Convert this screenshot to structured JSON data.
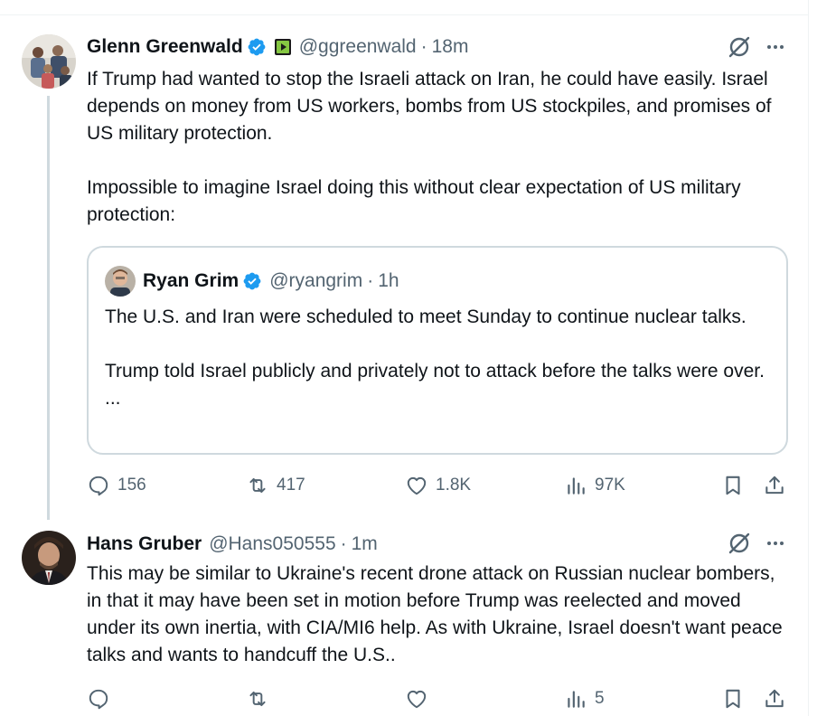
{
  "tweets": [
    {
      "author": "Glenn Greenwald",
      "handle": "@ggreenwald",
      "time": "18m",
      "verified": true,
      "text": "If Trump had wanted to stop the Israeli attack on Iran, he could have easily. Israel depends on money from US workers, bombs from US stockpiles, and promises of US military protection.\n\nImpossible to imagine Israel doing this without clear expectation of US military protection:",
      "quote": {
        "author": "Ryan Grim",
        "handle": "@ryangrim",
        "time": "1h",
        "verified": true,
        "text": "The U.S. and Iran were scheduled to meet Sunday to continue nuclear talks.\n\nTrump told Israel publicly and privately not to attack before the talks were over. ..."
      },
      "actions": {
        "replies": "156",
        "reposts": "417",
        "likes": "1.8K",
        "views": "97K"
      }
    },
    {
      "author": "Hans Gruber",
      "handle": "@Hans050555",
      "time": "1m",
      "verified": false,
      "text": "This may be similar to Ukraine's recent drone attack on Russian nuclear bombers, in that it may have been set in motion before Trump was reelected and moved under its own inertia, with CIA/MI6 help. As with Ukraine, Israel doesn't want peace talks and wants to handcuff the U.S..",
      "actions": {
        "replies": "",
        "reposts": "",
        "likes": "",
        "views": "5"
      }
    }
  ],
  "separator": "·",
  "colors": {
    "verified": "#1d9bf0",
    "secondary": "#536471",
    "border": "#cfd9de",
    "text": "#0f1419"
  }
}
